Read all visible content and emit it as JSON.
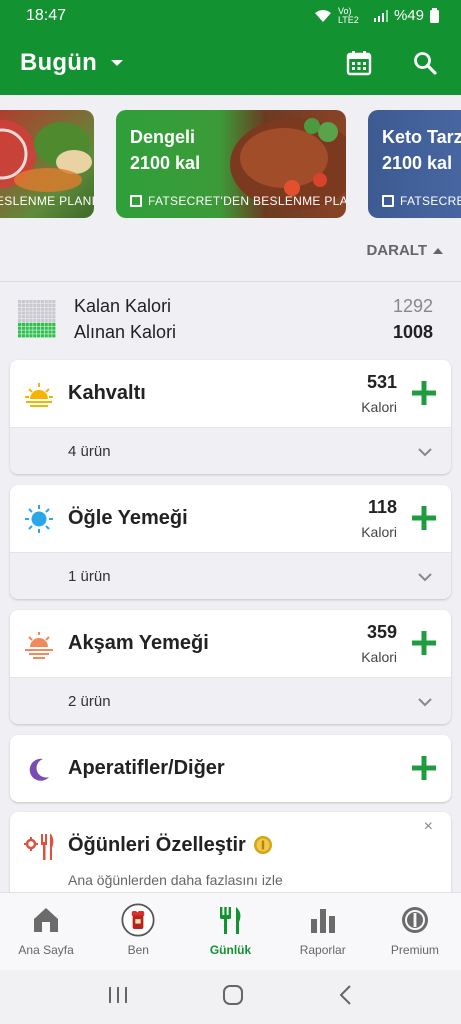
{
  "status_bar": {
    "time": "18:47",
    "network": "Vo) LTE2",
    "battery": "%49"
  },
  "app_bar": {
    "title": "Bugün",
    "calendar_icon": "calendar-icon",
    "search_icon": "search-icon"
  },
  "carousel": {
    "cards": [
      {
        "title_line1": "",
        "title_line2": "",
        "subtitle": "ESLENME PLANI",
        "color": "#c9493e"
      },
      {
        "title_line1": "Dengeli",
        "title_line2": "2100 kal",
        "subtitle": "FATSECRET'DEN BESLENME PLANI",
        "color": "#2d9a3a"
      },
      {
        "title_line1": "Keto Tarzı",
        "title_line2": "2100 kal",
        "subtitle": "FATSECRET'DEN",
        "color": "#3e5f9a"
      }
    ]
  },
  "collapse": {
    "label": "DARALT"
  },
  "summary": {
    "remaining_label": "Kalan Kalori",
    "remaining_value": "1292",
    "consumed_label": "Alınan Kalori",
    "consumed_value": "1008"
  },
  "meals": [
    {
      "name": "Kahvaltı",
      "calories": "531",
      "unit": "Kalori",
      "items": "4 ürün",
      "icon": "sunrise-icon"
    },
    {
      "name": "Öğle Yemeği",
      "calories": "118",
      "unit": "Kalori",
      "items": "1 ürün",
      "icon": "sun-icon"
    },
    {
      "name": "Akşam Yemeği",
      "calories": "359",
      "unit": "Kalori",
      "items": "2 ürün",
      "icon": "sunset-icon"
    },
    {
      "name": "Aperatifler/Diğer",
      "icon": "moon-icon"
    }
  ],
  "promo": {
    "title": "Öğünleri Özelleştir",
    "description": "Ana öğünlerden daha fazlasını izle",
    "close": "×"
  },
  "bottom_nav": [
    {
      "label": "Ana Sayfa",
      "icon": "home-icon"
    },
    {
      "label": "Ben",
      "icon": "profile-avatar-icon"
    },
    {
      "label": "Günlük",
      "icon": "fork-knife-icon"
    },
    {
      "label": "Raporlar",
      "icon": "bar-chart-icon"
    },
    {
      "label": "Premium",
      "icon": "premium-badge-icon"
    }
  ],
  "colors": {
    "brand_green": "#139232",
    "breakfast": "#f5b400",
    "lunch": "#29a7e8",
    "dinner": "#f08a5d",
    "snack": "#7a4bb5"
  }
}
